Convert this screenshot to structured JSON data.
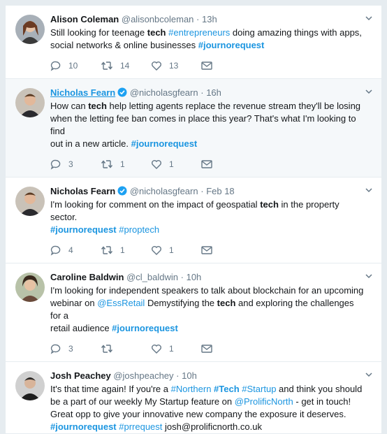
{
  "tweets": [
    {
      "name": "Alison Coleman",
      "handle": "@alisonbcoleman",
      "dot": "·",
      "time": "13h",
      "verified": false,
      "highlight": false,
      "body": [
        [
          {
            "t": "Still looking for teenage ",
            "s": ""
          },
          {
            "t": "tech",
            "s": "b"
          },
          {
            "t": " ",
            "s": ""
          },
          {
            "t": "#entrepreneurs",
            "s": "tag"
          },
          {
            "t": " doing amazing things with apps,",
            "s": ""
          }
        ],
        [
          {
            "t": "social networks & online businesses ",
            "s": ""
          },
          {
            "t": "#journorequest",
            "s": "tagb"
          }
        ]
      ],
      "replies": "10",
      "retweets": "14",
      "likes": "13"
    },
    {
      "name": "Nicholas Fearn",
      "handle": "@nicholasgfearn",
      "dot": "·",
      "time": "16h",
      "verified": true,
      "highlight": true,
      "body": [
        [
          {
            "t": "How can ",
            "s": ""
          },
          {
            "t": "tech",
            "s": "b"
          },
          {
            "t": " help letting agents replace the revenue stream they'll be losing",
            "s": ""
          }
        ],
        [
          {
            "t": "when the letting fee ban comes in place this year? That's what I'm looking to find",
            "s": ""
          }
        ],
        [
          {
            "t": "out in a new article. ",
            "s": ""
          },
          {
            "t": "#journorequest",
            "s": "tagb"
          }
        ]
      ],
      "replies": "3",
      "retweets": "1",
      "likes": "1"
    },
    {
      "name": "Nicholas Fearn",
      "handle": "@nicholasgfearn",
      "dot": "·",
      "time": "Feb 18",
      "verified": true,
      "highlight": false,
      "body": [
        [
          {
            "t": "I'm looking for comment on the impact of geospatial ",
            "s": ""
          },
          {
            "t": "tech",
            "s": "b"
          },
          {
            "t": " in the property sector.",
            "s": ""
          }
        ],
        [
          {
            "t": "#journorequest",
            "s": "tagb"
          },
          {
            "t": " ",
            "s": ""
          },
          {
            "t": "#proptech",
            "s": "tag"
          }
        ]
      ],
      "replies": "4",
      "retweets": "1",
      "likes": "1"
    },
    {
      "name": "Caroline Baldwin",
      "handle": "@cl_baldwin",
      "dot": "·",
      "time": "10h",
      "verified": false,
      "highlight": false,
      "body": [
        [
          {
            "t": "I'm looking for independent speakers to talk about blockchain for an upcoming",
            "s": ""
          }
        ],
        [
          {
            "t": "webinar on ",
            "s": ""
          },
          {
            "t": "@EssRetail",
            "s": "tag"
          },
          {
            "t": " Demystifying the ",
            "s": ""
          },
          {
            "t": "tech",
            "s": "b"
          },
          {
            "t": " and exploring the challenges for a",
            "s": ""
          }
        ],
        [
          {
            "t": "retail audience ",
            "s": ""
          },
          {
            "t": "#journorequest",
            "s": "tagb"
          }
        ]
      ],
      "replies": "3",
      "retweets": "",
      "likes": "1"
    },
    {
      "name": "Josh Peachey",
      "handle": "@joshpeachey",
      "dot": "·",
      "time": "10h",
      "verified": false,
      "highlight": false,
      "body": [
        [
          {
            "t": "It's that time again! If you're a ",
            "s": ""
          },
          {
            "t": "#Northern",
            "s": "tag"
          },
          {
            "t": " ",
            "s": ""
          },
          {
            "t": "#Tech",
            "s": "tagb"
          },
          {
            "t": " ",
            "s": ""
          },
          {
            "t": "#Startup",
            "s": "tag"
          },
          {
            "t": " and think you should",
            "s": ""
          }
        ],
        [
          {
            "t": "be a part of our weekly My Startup feature on ",
            "s": ""
          },
          {
            "t": "@ProlificNorth",
            "s": "tag"
          },
          {
            "t": " - get in touch!",
            "s": ""
          }
        ],
        [
          {
            "t": "Great opp to give your innovative new company the exposure it deserves.",
            "s": ""
          }
        ],
        [
          {
            "t": "#journorequest",
            "s": "tagb"
          },
          {
            "t": " ",
            "s": ""
          },
          {
            "t": "#prrequest",
            "s": "tag"
          },
          {
            "t": " josh@prolificnorth.co.uk",
            "s": ""
          }
        ]
      ],
      "replies": "",
      "retweets": "",
      "likes": ""
    }
  ]
}
